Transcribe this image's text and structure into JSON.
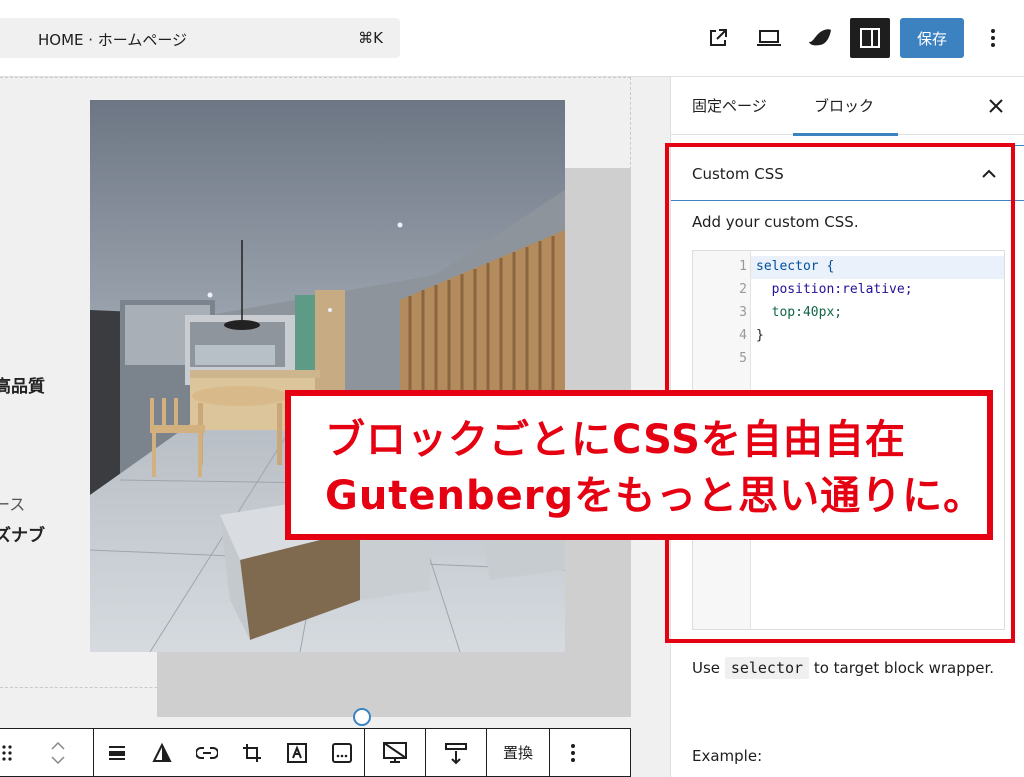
{
  "topbar": {
    "doc_title": "HOME · ホームページ",
    "shortcut": "⌘K",
    "save_label": "保存"
  },
  "canvas": {
    "left_text_1": "高品質",
    "left_text_2": "ース",
    "left_text_3": "ズナブ"
  },
  "block_toolbar": {
    "replace_label": "置換"
  },
  "sidebar": {
    "tabs": [
      {
        "label": "固定ページ",
        "active": false
      },
      {
        "label": "ブロック",
        "active": true
      }
    ],
    "section_title": "Custom CSS",
    "help_text": "Add your custom CSS.",
    "code_lines": [
      {
        "num": "1",
        "text": "selector {"
      },
      {
        "num": "2",
        "text": "  position:relative;"
      },
      {
        "num": "3",
        "text": "  top:40px;"
      },
      {
        "num": "4",
        "text": "}"
      },
      {
        "num": "5",
        "text": ""
      }
    ],
    "use_prefix": "Use",
    "use_code": "selector",
    "use_suffix": "to target block wrapper.",
    "example_label": "Example:"
  },
  "overlay": {
    "line1": "ブロックごとにCSSを自由自在",
    "line2": "Gutenbergをもっと思い通りに。"
  },
  "colors": {
    "accent": "#3c82c0",
    "annotation": "#e50012"
  }
}
